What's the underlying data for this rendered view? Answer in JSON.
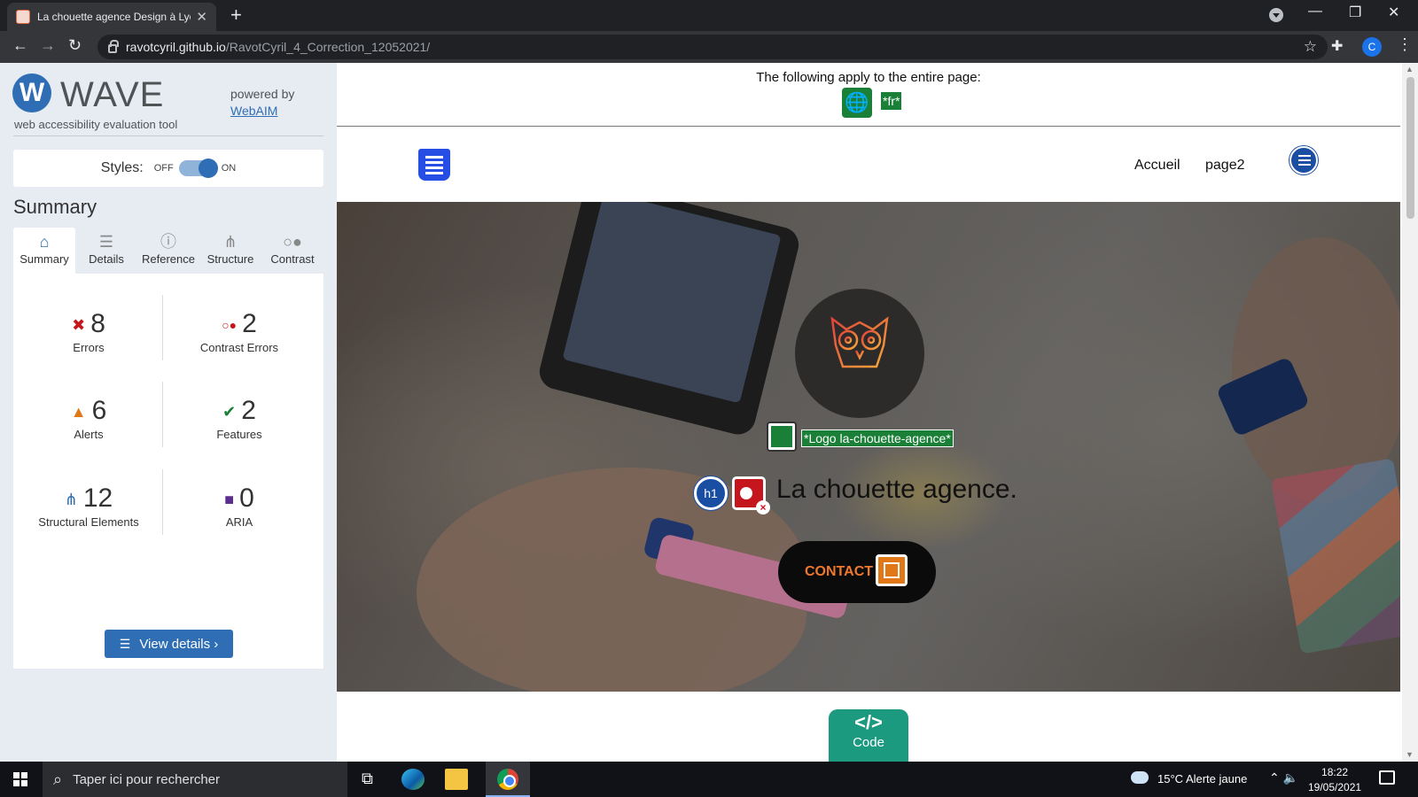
{
  "browser": {
    "tab_title": "La chouette agence Design à Lyon",
    "tab_close": "✕",
    "new_tab": "+",
    "url_host": "ravotcyril.github.io",
    "url_path": "/RavotCyril_4_Correction_12052021/",
    "profile_initial": "C",
    "window_controls": {
      "minimize": "—",
      "restore": "❐",
      "close": "✕"
    }
  },
  "wave": {
    "logo_letter": "W",
    "title": "WAVE",
    "subtitle": "web accessibility evaluation tool",
    "powered_by": "powered by",
    "powered_link": "WebAIM",
    "styles_label": "Styles:",
    "styles_off": "OFF",
    "styles_on": "ON",
    "styles_state": "on",
    "summary_heading": "Summary",
    "tabs": [
      {
        "label": "Summary",
        "icon": "home-icon",
        "active": true
      },
      {
        "label": "Details",
        "icon": "list-icon",
        "active": false
      },
      {
        "label": "Reference",
        "icon": "info-icon",
        "active": false
      },
      {
        "label": "Structure",
        "icon": "hierarchy-icon",
        "active": false
      },
      {
        "label": "Contrast",
        "icon": "contrast-icon",
        "active": false
      }
    ],
    "stats": {
      "errors": {
        "count": "8",
        "label": "Errors"
      },
      "contrast_errors": {
        "count": "2",
        "label": "Contrast Errors"
      },
      "alerts": {
        "count": "6",
        "label": "Alerts"
      },
      "features": {
        "count": "2",
        "label": "Features"
      },
      "structural": {
        "count": "12",
        "label": "Structural Elements"
      },
      "aria": {
        "count": "0",
        "label": "ARIA"
      }
    },
    "view_details": "View details ›",
    "accent": "#2f6db4"
  },
  "page": {
    "apply_text": "The following apply to the entire page:",
    "lang_tag": "*fr*",
    "nav": {
      "accueil": "Accueil",
      "page2": "page2"
    },
    "logo_alt": "*Logo la-chouette-agence*",
    "h1_badge": "h1",
    "hero_title": "La chouette agence.",
    "contact_label": "CONTACT",
    "code_symbol": "</>",
    "code_label": "Code"
  },
  "taskbar": {
    "search_placeholder": "Taper ici pour rechercher",
    "weather": "15°C  Alerte jaune",
    "time": "18:22",
    "date": "19/05/2021"
  }
}
